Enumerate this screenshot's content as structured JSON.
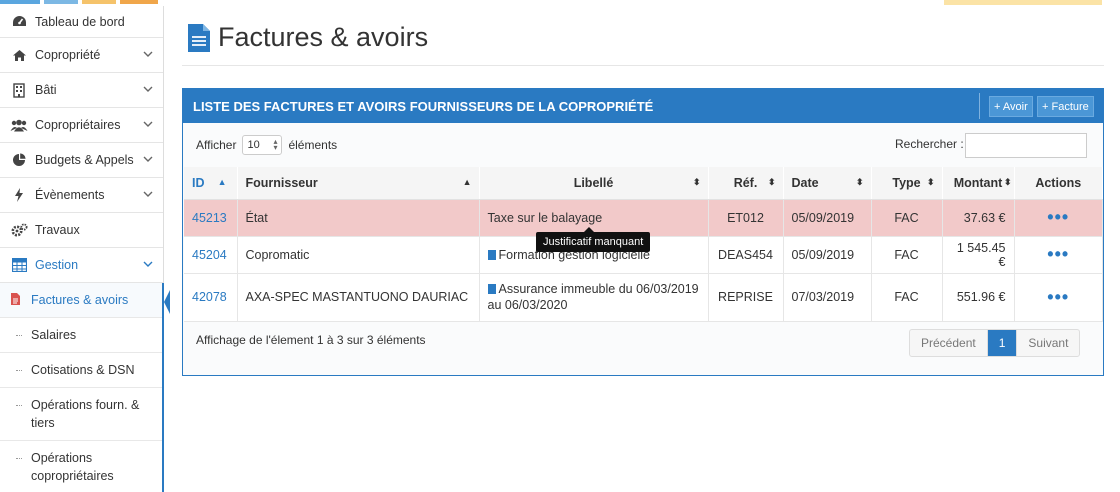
{
  "sidebar": {
    "items": [
      {
        "label": "Tableau de bord",
        "icon": "dashboard-icon"
      },
      {
        "label": "Copropriété",
        "icon": "home-icon"
      },
      {
        "label": "Bâti",
        "icon": "building-icon"
      },
      {
        "label": "Copropriétaires",
        "icon": "users-icon"
      },
      {
        "label": "Budgets & Appels",
        "icon": "pie-chart-icon"
      },
      {
        "label": "Évènements",
        "icon": "bolt-icon"
      },
      {
        "label": "Travaux",
        "icon": "cogs-icon"
      },
      {
        "label": "Gestion",
        "icon": "grid-icon"
      }
    ],
    "sub_items": [
      {
        "label": "Factures & avoirs"
      },
      {
        "label": "Salaires"
      },
      {
        "label": "Cotisations & DSN"
      },
      {
        "label": "Opérations fourn. & tiers"
      },
      {
        "label": "Opérations copropriétaires"
      }
    ]
  },
  "page": {
    "title": "Factures & avoirs"
  },
  "panel": {
    "title": "LISTE DES FACTURES ET AVOIRS FOURNISSEURS DE LA COPROPRIÉTÉ",
    "btn_avoir": "+ Avoir",
    "btn_facture": "+ Facture",
    "show_label": "Afficher",
    "show_value": "10",
    "show_suffix": "éléments",
    "search_label": "Rechercher :",
    "search_value": ""
  },
  "table": {
    "headers": [
      "ID",
      "Fournisseur",
      "Libellé",
      "Réf.",
      "Date",
      "Type",
      "Montant",
      "Actions"
    ],
    "rows": [
      {
        "id": "45213",
        "fournisseur": "État",
        "libelle": "Taxe sur le balayage",
        "ref": "ET012",
        "date": "05/09/2019",
        "type": "FAC",
        "montant": "37.63 €",
        "actions": "•••"
      },
      {
        "id": "45204",
        "fournisseur": "Copromatic",
        "libelle": "Formation gestion logicielle",
        "ref": "DEAS454",
        "date": "05/09/2019",
        "type": "FAC",
        "montant": "1 545.45 €",
        "actions": "•••"
      },
      {
        "id": "42078",
        "fournisseur": "AXA-SPEC MASTANTUONO DAURIAC",
        "libelle": "Assurance immeuble du 06/03/2019 au 06/03/2020",
        "ref": "REPRISE",
        "date": "07/03/2019",
        "type": "FAC",
        "montant": "551.96 €",
        "actions": "•••"
      }
    ]
  },
  "tooltip": "Justificatif manquant",
  "footer": {
    "info": "Affichage de l'élement 1 à 3 sur 3 éléments",
    "prev": "Précédent",
    "page": "1",
    "next": "Suivant"
  },
  "colors": {
    "primary": "#2a7ac2",
    "error_row": "#f2c9c9"
  }
}
